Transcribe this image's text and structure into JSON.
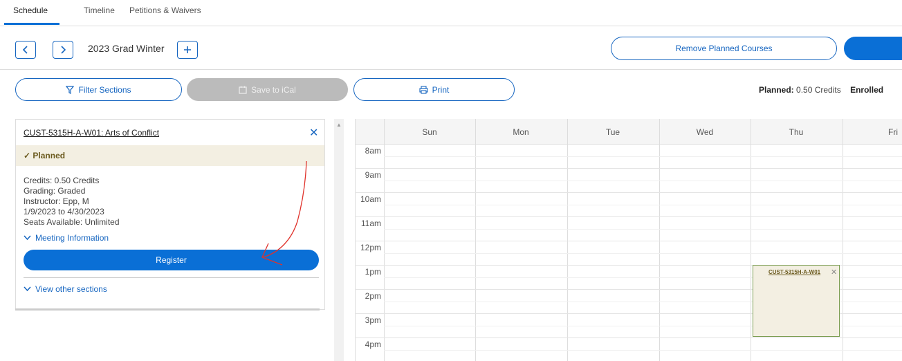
{
  "tabs": [
    {
      "label": "Schedule"
    },
    {
      "label": "Timeline"
    },
    {
      "label": "Petitions & Waivers"
    }
  ],
  "term": {
    "label": "2023 Grad Winter"
  },
  "buttons": {
    "remove_planned": "Remove Planned Courses",
    "filter": "Filter Sections",
    "ical": "Save to iCal",
    "print": "Print"
  },
  "credits": {
    "planned_label": "Planned:",
    "planned_value": "0.50 Credits",
    "enrolled_label": "Enrolled"
  },
  "course": {
    "title": "CUST-5315H-A-W01: Arts of Conflict",
    "status": "Planned",
    "credits": "Credits: 0.50 Credits",
    "grading": "Grading: Graded",
    "instructor": "Instructor: Epp, M",
    "dates": "1/9/2023 to 4/30/2023",
    "seats": "Seats Available:  Unlimited",
    "meeting_info": "Meeting Information",
    "register": "Register",
    "other_sections": "View other sections"
  },
  "calendar": {
    "days": [
      "Sun",
      "Mon",
      "Tue",
      "Wed",
      "Thu",
      "Fri"
    ],
    "times": [
      "8am",
      "9am",
      "10am",
      "11am",
      "12pm",
      "1pm",
      "2pm",
      "3pm",
      "4pm"
    ],
    "event": {
      "label": "CUST-5315H-A-W01",
      "day": "Thu",
      "start": "1pm",
      "end": "4pm"
    }
  },
  "annotation": {
    "color": "#e0322b"
  },
  "colors": {
    "accent": "#0a6fd6",
    "planned_bg": "#f3efe2"
  }
}
